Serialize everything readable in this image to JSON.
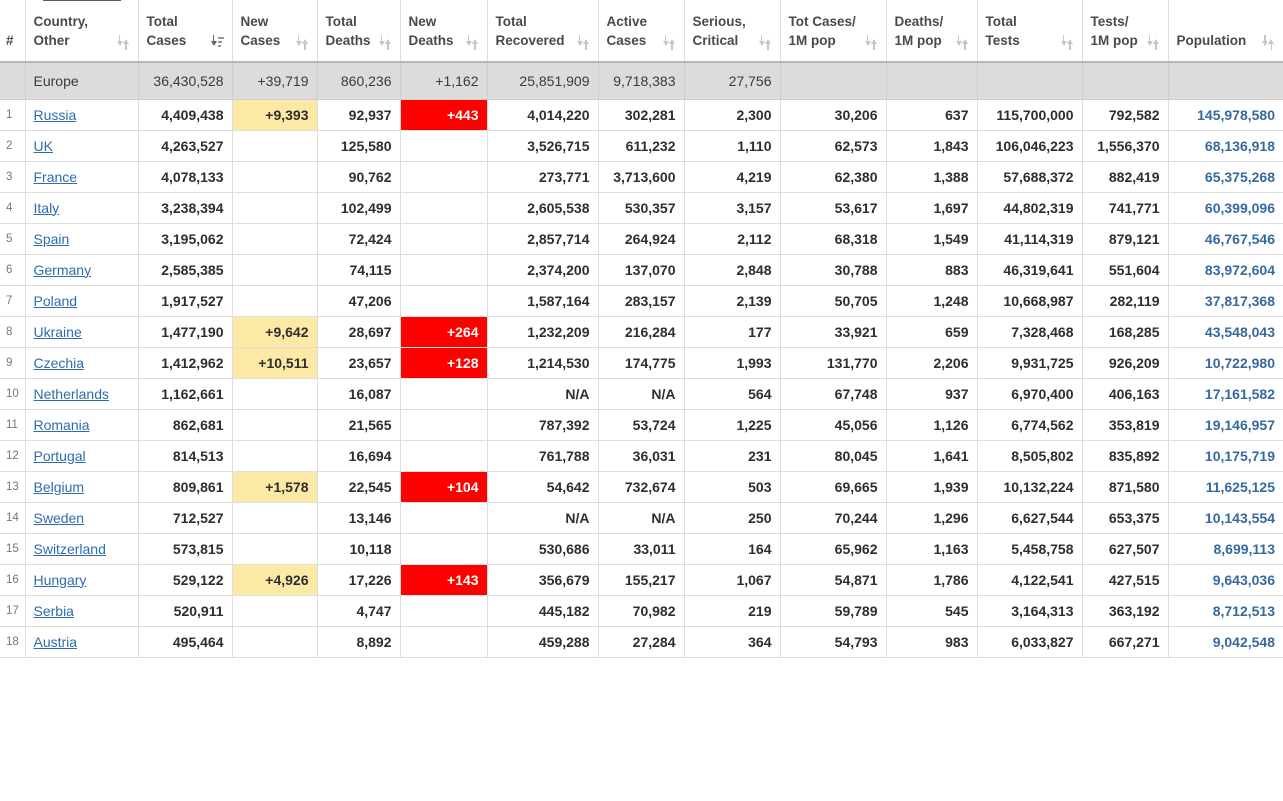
{
  "table": {
    "columns": [
      {
        "key": "rank",
        "label": "#",
        "sort": "none"
      },
      {
        "key": "country",
        "label": "Country,\nOther",
        "sort": "both"
      },
      {
        "key": "totalCases",
        "label": "Total\nCases",
        "sort": "desc"
      },
      {
        "key": "newCases",
        "label": "New\nCases",
        "sort": "both"
      },
      {
        "key": "totalDeaths",
        "label": "Total\nDeaths",
        "sort": "both"
      },
      {
        "key": "newDeaths",
        "label": "New\nDeaths",
        "sort": "both"
      },
      {
        "key": "totalRecovered",
        "label": "Total\nRecovered",
        "sort": "both"
      },
      {
        "key": "activeCases",
        "label": "Active\nCases",
        "sort": "both"
      },
      {
        "key": "serious",
        "label": "Serious,\nCritical",
        "sort": "both"
      },
      {
        "key": "casesPerM",
        "label": "Tot Cases/\n1M pop",
        "sort": "both"
      },
      {
        "key": "deathsPerM",
        "label": "Deaths/\n1M pop",
        "sort": "both"
      },
      {
        "key": "totalTests",
        "label": "Total\nTests",
        "sort": "both"
      },
      {
        "key": "testsPerM",
        "label": "Tests/\n1M pop",
        "sort": "both"
      },
      {
        "key": "population",
        "label": "Population",
        "sort": "both"
      }
    ],
    "aggregate": {
      "rank": "",
      "country": "Europe",
      "totalCases": "36,430,528",
      "newCases": "+39,719",
      "totalDeaths": "860,236",
      "newDeaths": "+1,162",
      "totalRecovered": "25,851,909",
      "activeCases": "9,718,383",
      "serious": "27,756",
      "casesPerM": "",
      "deathsPerM": "",
      "totalTests": "",
      "testsPerM": "",
      "population": ""
    },
    "rows": [
      {
        "rank": "1",
        "country": "Russia",
        "totalCases": "4,409,438",
        "newCases": "+9,393",
        "totalDeaths": "92,937",
        "newDeaths": "+443",
        "totalRecovered": "4,014,220",
        "activeCases": "302,281",
        "serious": "2,300",
        "casesPerM": "30,206",
        "deathsPerM": "637",
        "totalTests": "115,700,000",
        "testsPerM": "792,582",
        "population": "145,978,580"
      },
      {
        "rank": "2",
        "country": "UK",
        "totalCases": "4,263,527",
        "newCases": "",
        "totalDeaths": "125,580",
        "newDeaths": "",
        "totalRecovered": "3,526,715",
        "activeCases": "611,232",
        "serious": "1,110",
        "casesPerM": "62,573",
        "deathsPerM": "1,843",
        "totalTests": "106,046,223",
        "testsPerM": "1,556,370",
        "population": "68,136,918"
      },
      {
        "rank": "3",
        "country": "France",
        "totalCases": "4,078,133",
        "newCases": "",
        "totalDeaths": "90,762",
        "newDeaths": "",
        "totalRecovered": "273,771",
        "activeCases": "3,713,600",
        "serious": "4,219",
        "casesPerM": "62,380",
        "deathsPerM": "1,388",
        "totalTests": "57,688,372",
        "testsPerM": "882,419",
        "population": "65,375,268"
      },
      {
        "rank": "4",
        "country": "Italy",
        "totalCases": "3,238,394",
        "newCases": "",
        "totalDeaths": "102,499",
        "newDeaths": "",
        "totalRecovered": "2,605,538",
        "activeCases": "530,357",
        "serious": "3,157",
        "casesPerM": "53,617",
        "deathsPerM": "1,697",
        "totalTests": "44,802,319",
        "testsPerM": "741,771",
        "population": "60,399,096"
      },
      {
        "rank": "5",
        "country": "Spain",
        "totalCases": "3,195,062",
        "newCases": "",
        "totalDeaths": "72,424",
        "newDeaths": "",
        "totalRecovered": "2,857,714",
        "activeCases": "264,924",
        "serious": "2,112",
        "casesPerM": "68,318",
        "deathsPerM": "1,549",
        "totalTests": "41,114,319",
        "testsPerM": "879,121",
        "population": "46,767,546"
      },
      {
        "rank": "6",
        "country": "Germany",
        "totalCases": "2,585,385",
        "newCases": "",
        "totalDeaths": "74,115",
        "newDeaths": "",
        "totalRecovered": "2,374,200",
        "activeCases": "137,070",
        "serious": "2,848",
        "casesPerM": "30,788",
        "deathsPerM": "883",
        "totalTests": "46,319,641",
        "testsPerM": "551,604",
        "population": "83,972,604"
      },
      {
        "rank": "7",
        "country": "Poland",
        "totalCases": "1,917,527",
        "newCases": "",
        "totalDeaths": "47,206",
        "newDeaths": "",
        "totalRecovered": "1,587,164",
        "activeCases": "283,157",
        "serious": "2,139",
        "casesPerM": "50,705",
        "deathsPerM": "1,248",
        "totalTests": "10,668,987",
        "testsPerM": "282,119",
        "population": "37,817,368"
      },
      {
        "rank": "8",
        "country": "Ukraine",
        "totalCases": "1,477,190",
        "newCases": "+9,642",
        "totalDeaths": "28,697",
        "newDeaths": "+264",
        "totalRecovered": "1,232,209",
        "activeCases": "216,284",
        "serious": "177",
        "casesPerM": "33,921",
        "deathsPerM": "659",
        "totalTests": "7,328,468",
        "testsPerM": "168,285",
        "population": "43,548,043"
      },
      {
        "rank": "9",
        "country": "Czechia",
        "totalCases": "1,412,962",
        "newCases": "+10,511",
        "totalDeaths": "23,657",
        "newDeaths": "+128",
        "totalRecovered": "1,214,530",
        "activeCases": "174,775",
        "serious": "1,993",
        "casesPerM": "131,770",
        "deathsPerM": "2,206",
        "totalTests": "9,931,725",
        "testsPerM": "926,209",
        "population": "10,722,980"
      },
      {
        "rank": "10",
        "country": "Netherlands",
        "totalCases": "1,162,661",
        "newCases": "",
        "totalDeaths": "16,087",
        "newDeaths": "",
        "totalRecovered": "N/A",
        "activeCases": "N/A",
        "serious": "564",
        "casesPerM": "67,748",
        "deathsPerM": "937",
        "totalTests": "6,970,400",
        "testsPerM": "406,163",
        "population": "17,161,582"
      },
      {
        "rank": "11",
        "country": "Romania",
        "totalCases": "862,681",
        "newCases": "",
        "totalDeaths": "21,565",
        "newDeaths": "",
        "totalRecovered": "787,392",
        "activeCases": "53,724",
        "serious": "1,225",
        "casesPerM": "45,056",
        "deathsPerM": "1,126",
        "totalTests": "6,774,562",
        "testsPerM": "353,819",
        "population": "19,146,957"
      },
      {
        "rank": "12",
        "country": "Portugal",
        "totalCases": "814,513",
        "newCases": "",
        "totalDeaths": "16,694",
        "newDeaths": "",
        "totalRecovered": "761,788",
        "activeCases": "36,031",
        "serious": "231",
        "casesPerM": "80,045",
        "deathsPerM": "1,641",
        "totalTests": "8,505,802",
        "testsPerM": "835,892",
        "population": "10,175,719"
      },
      {
        "rank": "13",
        "country": "Belgium",
        "totalCases": "809,861",
        "newCases": "+1,578",
        "totalDeaths": "22,545",
        "newDeaths": "+104",
        "totalRecovered": "54,642",
        "activeCases": "732,674",
        "serious": "503",
        "casesPerM": "69,665",
        "deathsPerM": "1,939",
        "totalTests": "10,132,224",
        "testsPerM": "871,580",
        "population": "11,625,125"
      },
      {
        "rank": "14",
        "country": "Sweden",
        "totalCases": "712,527",
        "newCases": "",
        "totalDeaths": "13,146",
        "newDeaths": "",
        "totalRecovered": "N/A",
        "activeCases": "N/A",
        "serious": "250",
        "casesPerM": "70,244",
        "deathsPerM": "1,296",
        "totalTests": "6,627,544",
        "testsPerM": "653,375",
        "population": "10,143,554"
      },
      {
        "rank": "15",
        "country": "Switzerland",
        "totalCases": "573,815",
        "newCases": "",
        "totalDeaths": "10,118",
        "newDeaths": "",
        "totalRecovered": "530,686",
        "activeCases": "33,011",
        "serious": "164",
        "casesPerM": "65,962",
        "deathsPerM": "1,163",
        "totalTests": "5,458,758",
        "testsPerM": "627,507",
        "population": "8,699,113"
      },
      {
        "rank": "16",
        "country": "Hungary",
        "totalCases": "529,122",
        "newCases": "+4,926",
        "totalDeaths": "17,226",
        "newDeaths": "+143",
        "totalRecovered": "356,679",
        "activeCases": "155,217",
        "serious": "1,067",
        "casesPerM": "54,871",
        "deathsPerM": "1,786",
        "totalTests": "4,122,541",
        "testsPerM": "427,515",
        "population": "9,643,036"
      },
      {
        "rank": "17",
        "country": "Serbia",
        "totalCases": "520,911",
        "newCases": "",
        "totalDeaths": "4,747",
        "newDeaths": "",
        "totalRecovered": "445,182",
        "activeCases": "70,982",
        "serious": "219",
        "casesPerM": "59,789",
        "deathsPerM": "545",
        "totalTests": "3,164,313",
        "testsPerM": "363,192",
        "population": "8,712,513"
      },
      {
        "rank": "18",
        "country": "Austria",
        "totalCases": "495,464",
        "newCases": "",
        "totalDeaths": "8,892",
        "newDeaths": "",
        "totalRecovered": "459,288",
        "activeCases": "27,284",
        "serious": "364",
        "casesPerM": "54,793",
        "deathsPerM": "983",
        "totalTests": "6,033,827",
        "testsPerM": "667,271",
        "population": "9,042,548"
      }
    ]
  },
  "colors": {
    "new_cases_highlight": "#fbe9a5",
    "new_deaths_highlight": "#fd0000",
    "link": "#2e6cad",
    "population": "#36699e",
    "aggregate_row_bg": "#dcdcdc",
    "header_accent": "#565b66"
  }
}
